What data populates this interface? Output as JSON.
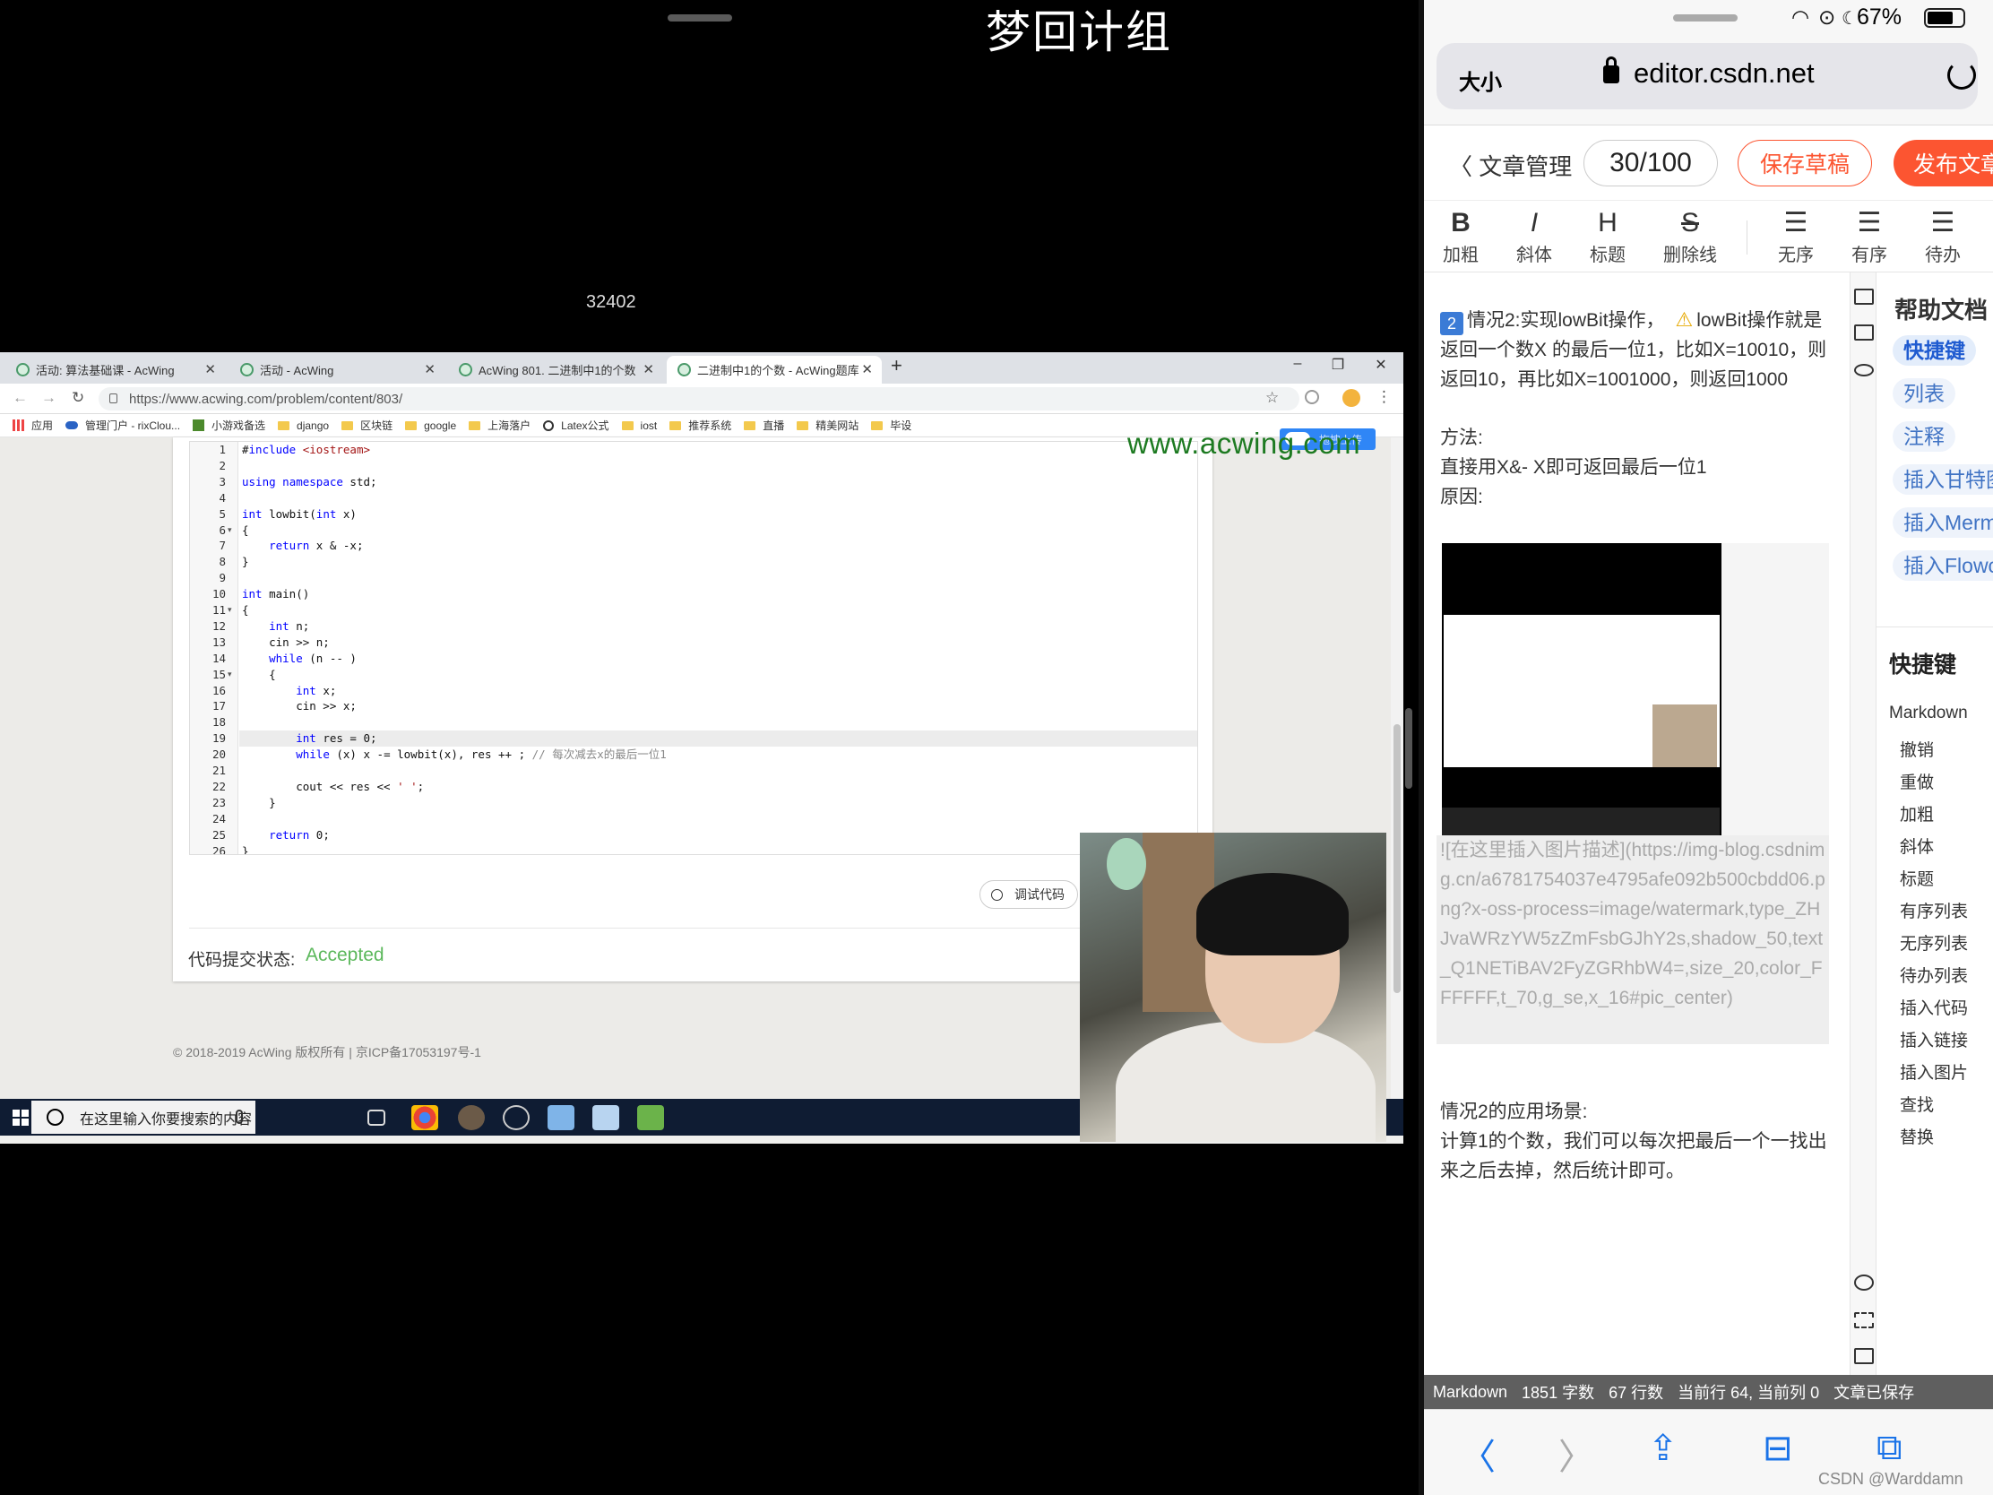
{
  "stream": {
    "title": "梦回计组",
    "counter": "32402"
  },
  "browser": {
    "tabs": [
      {
        "label": "活动: 算法基础课 - AcWing"
      },
      {
        "label": "活动 - AcWing"
      },
      {
        "label": "AcWing 801. 二进制中1的个数"
      },
      {
        "label": "二进制中1的个数 - AcWing题库"
      }
    ],
    "url": "https://www.acwing.com/problem/content/803/",
    "bookmarks": [
      "应用",
      "管理门户 - rixClou...",
      "小游戏备选",
      "django",
      "区块链",
      "google",
      "上海落户",
      "Latex公式",
      "iost",
      "推荐系统",
      "直播",
      "精美网站",
      "毕设"
    ],
    "upload_label": "拖拽上传"
  },
  "editor": {
    "lines": [
      "#include <iostream>",
      "",
      "using namespace std;",
      "",
      "int lowbit(int x)",
      "{",
      "    return x & -x;",
      "}",
      "",
      "int main()",
      "{",
      "    int n;",
      "    cin >> n;",
      "    while (n -- )",
      "    {",
      "        int x;",
      "        cin >> x;",
      "",
      "        int res = 0;",
      "        while (x) x -= lowbit(x), res ++ ; // 每次减去x的最后一位1",
      "",
      "        cout << res << ' ';",
      "    }",
      "",
      "    return 0;",
      "}"
    ],
    "line_numbers": [
      "1",
      "2",
      "3",
      "4",
      "5",
      "6",
      "7",
      "8",
      "9",
      "10",
      "11",
      "12",
      "13",
      "14",
      "15",
      "16",
      "17",
      "18",
      "19",
      "20",
      "21",
      "22",
      "23",
      "24",
      "25",
      "26"
    ],
    "debug_label": "调试代码",
    "status_label": "代码提交状态:",
    "status_value": "Accepted",
    "status_color": "#5cb85c"
  },
  "page": {
    "copyright": "© 2018-2019 AcWing 版权所有  |  京ICP备17053197号-1",
    "watermark": "www.acwing.com"
  },
  "taskbar": {
    "search_placeholder": "在这里输入你要搜索的内容"
  },
  "ipad": {
    "battery": "67%",
    "size_label": "大小",
    "domain": "editor.csdn.net"
  },
  "csdn": {
    "back_label": "文章管理",
    "word_count": "30/100",
    "save_label": "保存草稿",
    "publish_label": "发布文章",
    "accent": "#fc5531",
    "toolbar": [
      {
        "icon": "B",
        "label": "加粗"
      },
      {
        "icon": "I",
        "label": "斜体"
      },
      {
        "icon": "H",
        "label": "标题"
      },
      {
        "icon": "S",
        "label": "删除线"
      },
      {
        "icon": "☰",
        "label": "无序"
      },
      {
        "icon": "☰",
        "label": "有序"
      },
      {
        "icon": "☰",
        "label": "待办"
      }
    ],
    "content": {
      "badge": "2",
      "p1_a": "情况2:实现lowBit操作，",
      "p1_b": "lowBit操作就是返回一个数X 的最后一位1，比如X=10010，则返回10，再比如X=1001000，则返回1000",
      "p2": "方法:",
      "p3": "直接用X&- X即可返回最后一位1",
      "p4": "原因:",
      "mdlink": "![在这里插入图片描述](https://img-blog.csdnimg.cn/a6781754037e4795afe092b500cbdd06.png?x-oss-process=image/watermark,type_ZHJvaWRzYW5zZmFsbGJhY2s,shadow_50,text_Q1NETiBAV2FyZGRhbW4=,size_20,color_FFFFFF,t_70,g_se,x_16#pic_center)",
      "p5": "情况2的应用场景:",
      "p6": "计算1的个数，我们可以每次把最后一个一找出来之后去掉，然后统计即可。"
    },
    "help": {
      "title": "帮助文档",
      "pills": [
        "快捷键",
        "列表",
        "注释",
        "插入甘特图",
        "插入Mermaid",
        "插入Flowchart"
      ],
      "shortcut_title": "快捷键",
      "shortcuts": [
        "Markdown",
        "撤销",
        "重做",
        "加粗",
        "斜体",
        "标题",
        "有序列表",
        "无序列表",
        "待办列表",
        "插入代码",
        "插入链接",
        "插入图片",
        "查找",
        "替换"
      ]
    },
    "statusbar": {
      "mode": "Markdown",
      "chars": "1851 字数",
      "lines": "67 行数",
      "cursor": "当前行 64, 当前列 0",
      "saved": "文章已保存"
    },
    "credit": "CSDN @Warddamn"
  }
}
